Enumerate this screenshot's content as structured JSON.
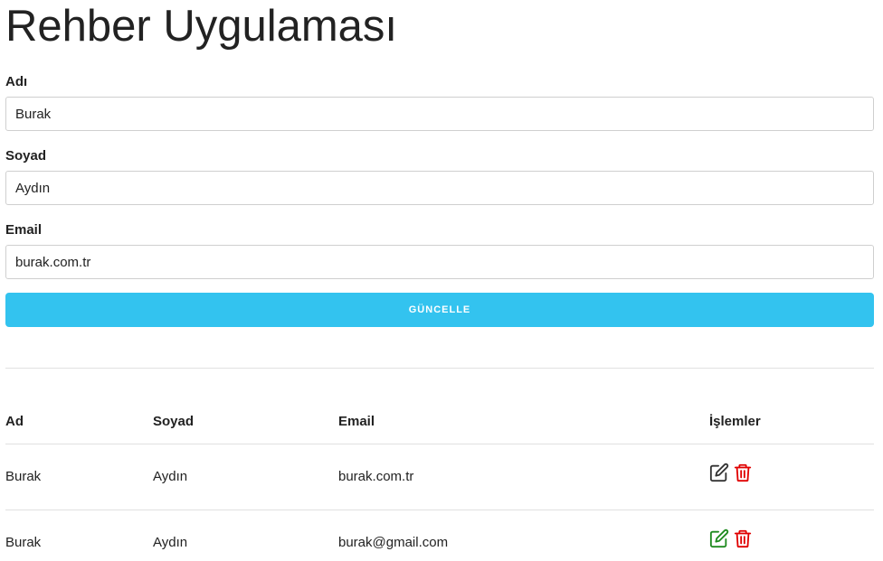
{
  "page": {
    "title": "Rehber Uygulaması"
  },
  "form": {
    "name_label": "Adı",
    "name_value": "Burak",
    "surname_label": "Soyad",
    "surname_value": "Aydın",
    "email_label": "Email",
    "email_value": "burak.com.tr",
    "submit_label": "GÜNCELLE"
  },
  "table": {
    "headers": [
      "Ad",
      "Soyad",
      "Email",
      "İşlemler"
    ],
    "rows": [
      {
        "name": "Burak",
        "surname": "Aydın",
        "email": "burak.com.tr",
        "edit_icon": "edit-icon",
        "delete_icon": "trash-icon",
        "edit_color": "#333333",
        "delete_color": "#e00000"
      },
      {
        "name": "Burak",
        "surname": "Aydın",
        "email": "burak@gmail.com",
        "edit_icon": "edit-icon",
        "delete_icon": "trash-icon",
        "edit_color": "#1e8a1e",
        "delete_color": "#e00000"
      }
    ]
  },
  "colors": {
    "accent": "#33c3ef",
    "danger": "#e00000",
    "success": "#1e8a1e"
  }
}
